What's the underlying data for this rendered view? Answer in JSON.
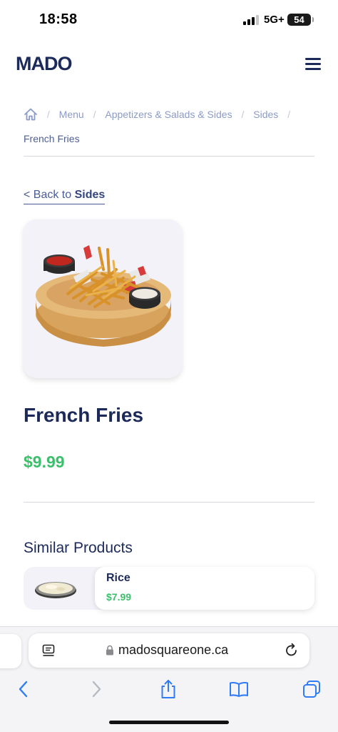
{
  "status_bar": {
    "time": "18:58",
    "network": "5G+",
    "battery": "54"
  },
  "header": {
    "logo": "MADO",
    "menu_icon": "hamburger-menu-icon"
  },
  "breadcrumb": {
    "home_icon": "home-icon",
    "separator": "/",
    "items": [
      "Menu",
      "Appetizers & Salads & Sides",
      "Sides"
    ],
    "current": "French Fries"
  },
  "back_link": {
    "prefix": "< Back to",
    "target": "Sides"
  },
  "product": {
    "name": "French Fries",
    "price": "$9.99",
    "image": "french-fries-platter"
  },
  "similar": {
    "title": "Similar Products",
    "items": [
      {
        "name": "Rice",
        "price": "$7.99",
        "image": "rice-dish"
      }
    ]
  },
  "browser": {
    "url": "madosquareone.ca"
  },
  "colors": {
    "navy": "#1c2a5a",
    "price_green": "#3bbf6a",
    "link_blue": "#4a5c95",
    "safari_blue": "#2f7cf6"
  }
}
